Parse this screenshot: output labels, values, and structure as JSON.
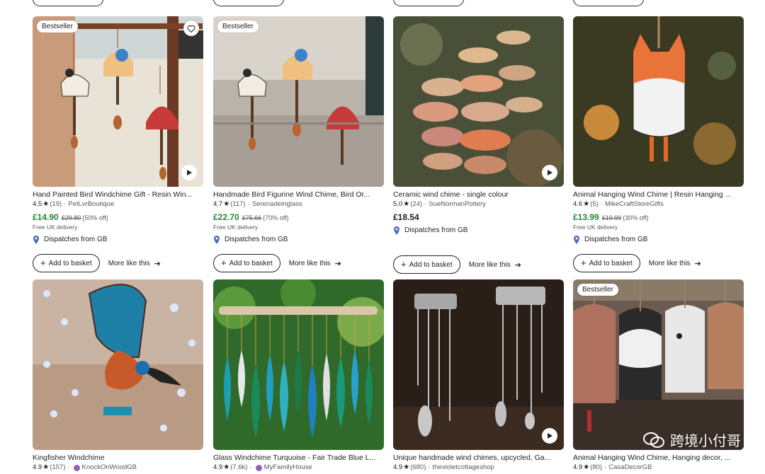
{
  "listings": [
    {
      "title": "Hand Painted Bird Windchime Gift - Resin Win...",
      "rating": "4.5",
      "reviews": "(19)",
      "shop": "PetLvrBoutique",
      "price": "£14.90",
      "original_price": "£29.80",
      "discount": "(50% off)",
      "delivery": "Free UK delivery",
      "dispatch": "Dispatches from GB",
      "badge": "Bestseller",
      "add_label": "Add to basket",
      "more_label": "More like this"
    },
    {
      "title": "Handmade Bird Figurine Wind Chime, Bird Or...",
      "rating": "4.7",
      "reviews": "(117)",
      "shop": "Serenadeinglass",
      "price": "£22.70",
      "original_price": "£75.66",
      "discount": "(70% off)",
      "delivery": "Free UK delivery",
      "dispatch": "Dispatches from GB",
      "badge": "Bestseller",
      "add_label": "Add to basket",
      "more_label": "More like this"
    },
    {
      "title": "Ceramic wind chime - single colour",
      "rating": "5.0",
      "reviews": "(24)",
      "shop": "SueNormanPottery",
      "price": "£18.54",
      "dispatch": "Dispatches from GB",
      "add_label": "Add to basket",
      "more_label": "More like this"
    },
    {
      "title": "Animal Hanging Wind Chime | Resin Hanging ...",
      "rating": "4.6",
      "reviews": "(5)",
      "shop": "MikeCraftStoreGifts",
      "price": "£13.99",
      "original_price": "£19.99",
      "discount": "(30% off)",
      "delivery": "Free UK delivery",
      "dispatch": "Dispatches from GB",
      "add_label": "Add to basket",
      "more_label": "More like this"
    },
    {
      "title": "Kingfisher Windchime",
      "rating": "4.9",
      "reviews": "(157)",
      "shop": "KnockOnWoodGB"
    },
    {
      "title": "Glass Windchime Turquoise - Fair Trade Blue L...",
      "rating": "4.9",
      "reviews": "(7.6k)",
      "shop": "MyFamilyHouse"
    },
    {
      "title": "Unique handmade wind chimes, upcycled, Ga...",
      "rating": "4.9",
      "reviews": "(680)",
      "shop": "thevioletcottageshop"
    },
    {
      "title": "Animal Hanging Wind Chime, Hanging decor, ...",
      "rating": "4.9",
      "reviews": "(80)",
      "shop": "CasaDecorGB",
      "badge": "Bestseller"
    }
  ],
  "separator": "·",
  "watermark": "跨境小付哥",
  "icons": {
    "star": "star-icon",
    "favourite": "heart-icon",
    "play": "play-icon",
    "pin": "location-pin-icon",
    "plus": "plus-icon",
    "arrow": "arrow-right-icon"
  },
  "colors": {
    "sale_price": "#258635",
    "text": "#222222",
    "muted": "#595959",
    "pin": "#4d6bc6"
  }
}
